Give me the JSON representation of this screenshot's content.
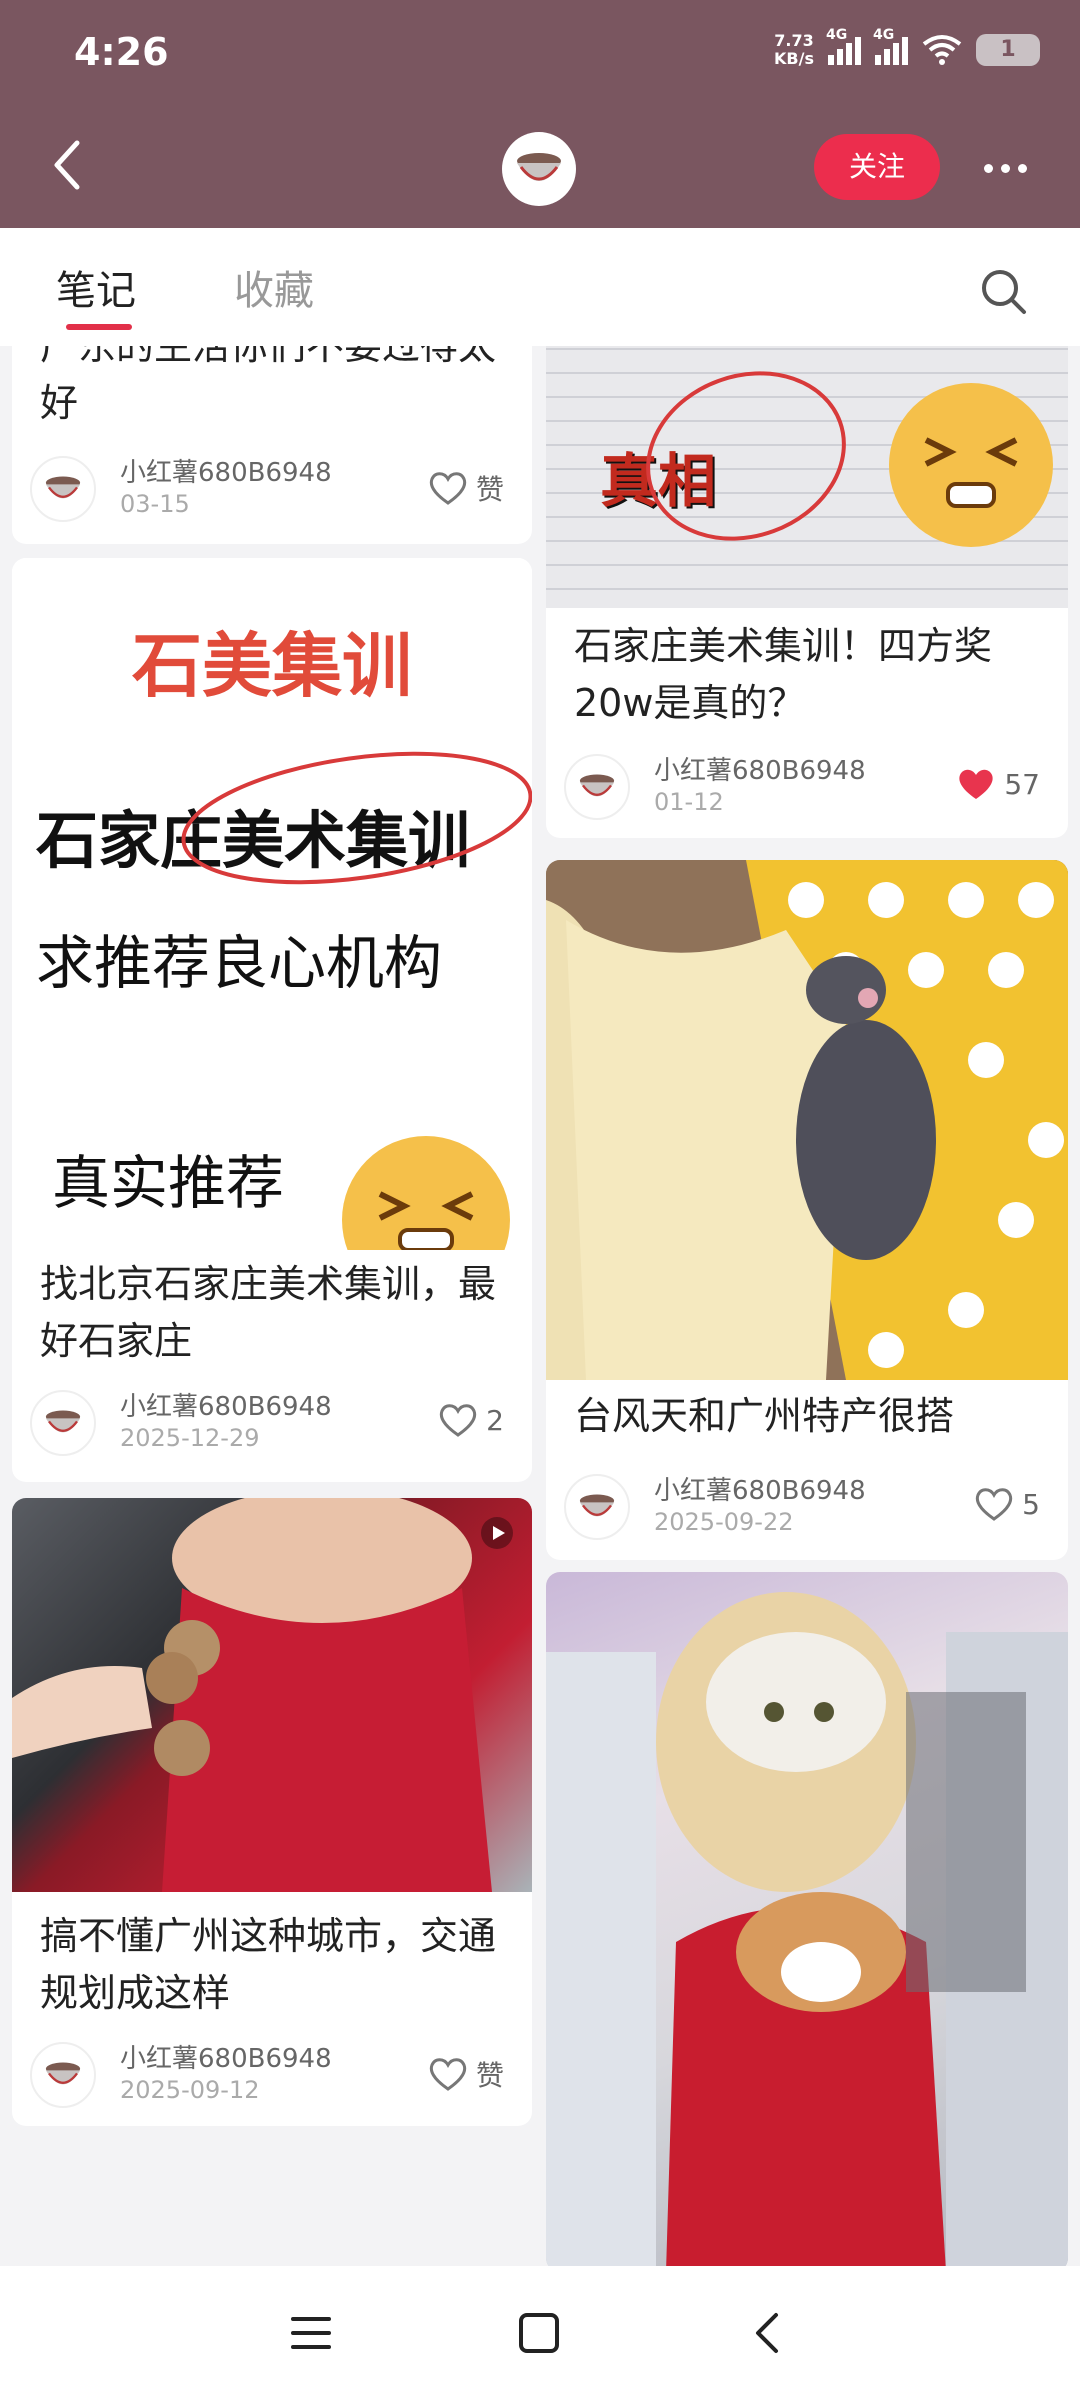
{
  "status": {
    "time": "4:26",
    "speed": "7.73",
    "speed_unit": "KB/s",
    "net1": "4G",
    "net2": "4G",
    "battery": "1"
  },
  "header": {
    "follow_label": "关注"
  },
  "tabs": [
    {
      "label": "笔记",
      "active": true
    },
    {
      "label": "收藏",
      "active": false
    }
  ],
  "colors": {
    "header_bg": "#7a5660",
    "accent": "#ec2d4d",
    "liked": "#e8344e"
  },
  "notes": [
    {
      "title": "广东的生活你们不要过得太好",
      "author": "小红薯680B6948",
      "date": "03-15",
      "likes": "赞",
      "liked": false
    },
    {
      "image_text": [
        "石美集训",
        "石家庄美术集训",
        "求推荐良心机构",
        "真实推荐"
      ],
      "title": "找北京石家庄美术集训，最好石家庄",
      "author": "小红薯680B6948",
      "date": "2025-12-29",
      "likes": "2",
      "liked": false
    },
    {
      "title": "搞不懂广州这种城市，交通规划成这样",
      "author": "小红薯680B6948",
      "date": "2025-09-12",
      "likes": "赞",
      "liked": false,
      "video": true
    },
    {
      "image_text": [
        "真相"
      ],
      "title": "石家庄美术集训！四方奖20w是真的？",
      "author": "小红薯680B6948",
      "date": "01-12",
      "likes": "57",
      "liked": true
    },
    {
      "title": "台风天和广州特产很搭",
      "author": "小红薯680B6948",
      "date": "2025-09-22",
      "likes": "5",
      "liked": false
    },
    {
      "title": "",
      "photo": true
    }
  ]
}
